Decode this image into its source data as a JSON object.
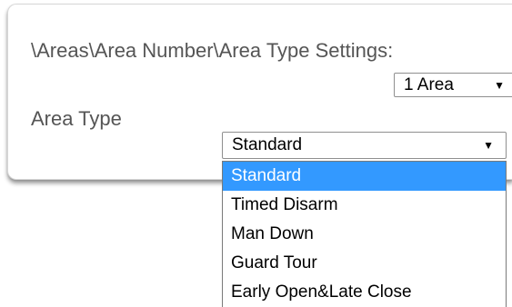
{
  "settings": {
    "path_label": "\\Areas\\Area Number\\Area Type Settings:",
    "area_number": {
      "selected": "1 Area"
    },
    "area_type_label": "Area Type",
    "area_type": {
      "selected": "Standard",
      "options": [
        {
          "label": "Standard",
          "highlighted": true
        },
        {
          "label": "Timed Disarm",
          "highlighted": false
        },
        {
          "label": "Man Down",
          "highlighted": false
        },
        {
          "label": "Guard Tour",
          "highlighted": false
        },
        {
          "label": "Early Open&Late Close",
          "highlighted": false
        }
      ]
    }
  },
  "icons": {
    "dropdown_arrow": "caret-down-icon"
  },
  "colors": {
    "highlight": "#3399ff",
    "label_text": "#555555"
  }
}
